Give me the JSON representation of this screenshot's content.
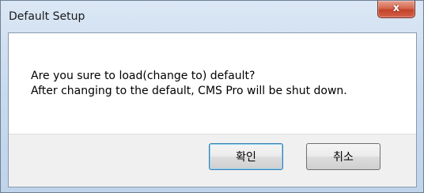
{
  "window": {
    "title": "Default Setup",
    "close_glyph": "x"
  },
  "message": {
    "line1": "Are you sure to load(change to) default?",
    "line2": "After changing to the default, CMS Pro will be shut down."
  },
  "buttons": {
    "ok_label": "확인",
    "cancel_label": "취소"
  },
  "icons": {
    "close": "close-icon"
  },
  "colors": {
    "close_button": "#c3432a",
    "title_bar": "#c9dbef",
    "ok_focus_border": "#3c7fb1"
  }
}
